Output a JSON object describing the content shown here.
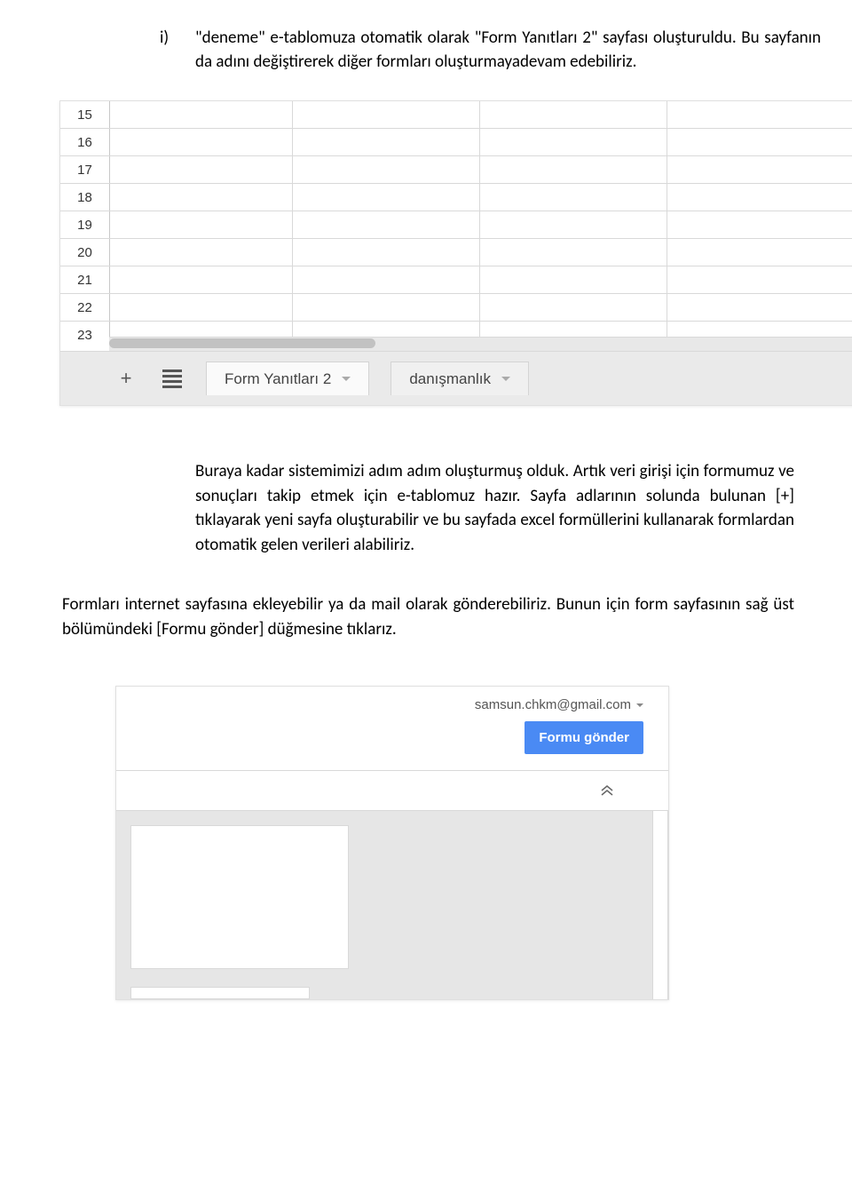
{
  "list_marker": "i)",
  "para1": "\"deneme\" e-tablomuza otomatik olarak \"Form Yanıtları 2\" sayfası oluşturuldu. Bu sayfanın da adını değiştirerek diğer formları oluşturmayadevam edebiliriz.",
  "sheet": {
    "rows": [
      "15",
      "16",
      "17",
      "18",
      "19",
      "20",
      "21",
      "22",
      "23"
    ],
    "tabs": [
      "Form Yanıtları 2",
      "danışmanlık"
    ]
  },
  "para2": "Buraya kadar sistemimizi adım adım oluşturmuş olduk. Artık veri girişi için formumuz ve sonuçları takip etmek için e-tablomuz hazır. Sayfa adlarının solunda bulunan [+] tıklayarak yeni sayfa oluşturabilir ve bu sayfada excel formüllerini kullanarak formlardan otomatik gelen verileri alabiliriz.",
  "para3": "Formları internet sayfasına ekleyebilir ya da mail olarak gönderebiliriz. Bunun için form sayfasının sağ üst bölümündeki [Formu gönder] düğmesine tıklarız.",
  "form": {
    "email": "samsun.chkm@gmail.com",
    "send_button": "Formu gönder"
  }
}
